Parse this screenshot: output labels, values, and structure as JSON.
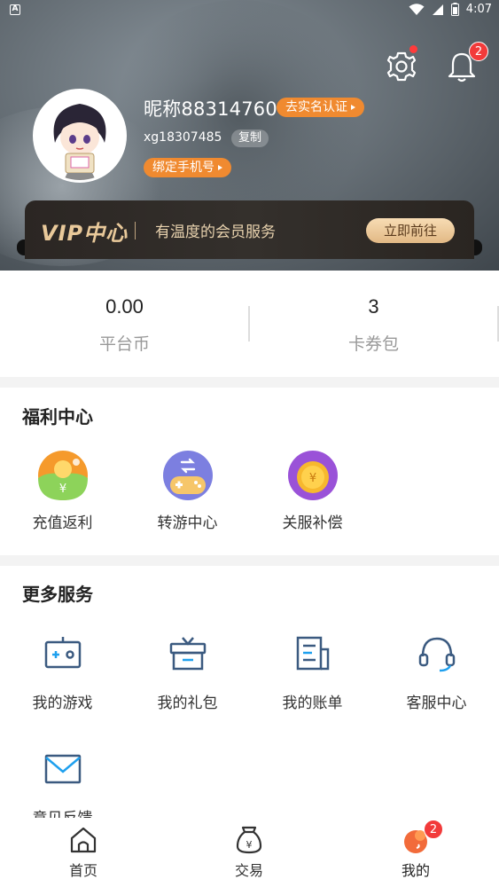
{
  "status_bar": {
    "time": "4:07",
    "app_indicator": "A"
  },
  "header": {
    "settings_icon": "gear-icon",
    "notifications_badge": "2",
    "nickname": "昵称88314760",
    "realname_label": "去实名认证",
    "username": "xg18307485",
    "copy_label": "复制",
    "bind_phone_label": "绑定手机号"
  },
  "vip": {
    "title": "VIP中心",
    "description": "有温度的会员服务",
    "button": "立即前往"
  },
  "stats": [
    {
      "value": "0.00",
      "label": "平台币"
    },
    {
      "value": "3",
      "label": "卡券包"
    }
  ],
  "welfare": {
    "title": "福利中心",
    "items": [
      {
        "label": "充值返利",
        "icon": "recharge-rebate-icon"
      },
      {
        "label": "转游中心",
        "icon": "game-transfer-icon"
      },
      {
        "label": "关服补偿",
        "icon": "server-compensation-icon"
      }
    ]
  },
  "services": {
    "title": "更多服务",
    "items": [
      {
        "label": "我的游戏",
        "icon": "gamepad-icon"
      },
      {
        "label": "我的礼包",
        "icon": "gift-icon"
      },
      {
        "label": "我的账单",
        "icon": "bill-icon"
      },
      {
        "label": "客服中心",
        "icon": "headset-icon"
      },
      {
        "label": "意见反馈",
        "icon": "mail-icon"
      }
    ]
  },
  "bottom_nav": {
    "items": [
      {
        "label": "首页",
        "icon": "home-icon"
      },
      {
        "label": "交易",
        "icon": "money-bag-icon"
      },
      {
        "label": "我的",
        "icon": "profile-icon",
        "badge": "2"
      }
    ]
  },
  "colors": {
    "accent": "#f08a30",
    "badge": "#f23a3a",
    "vip_gold": "#e9c99a",
    "service_icon": "#3b5a80"
  }
}
